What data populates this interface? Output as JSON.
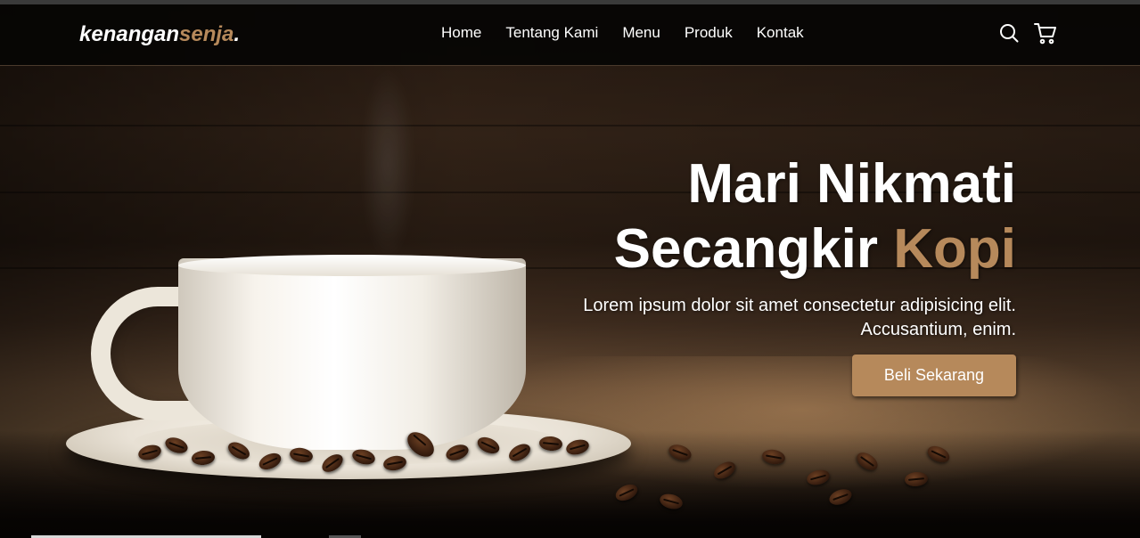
{
  "brand": {
    "name_main": "kenangan",
    "name_accent": "senja",
    "name_dot": "."
  },
  "nav": {
    "links": [
      "Home",
      "Tentang Kami",
      "Menu",
      "Produk",
      "Kontak"
    ],
    "icons": [
      "search-icon",
      "shopping-cart-icon"
    ]
  },
  "hero": {
    "title_line1": "Mari Nikmati",
    "title_line2_main": "Secangkir ",
    "title_line2_accent": "Kopi",
    "description": "Lorem ipsum dolor sit amet consectetur adipisicing elit. Accusantium, enim.",
    "cta_label": "Beli Sekarang"
  },
  "colors": {
    "accent": "#b6895b",
    "navbar_bg": "#060504",
    "text": "#ffffff"
  }
}
